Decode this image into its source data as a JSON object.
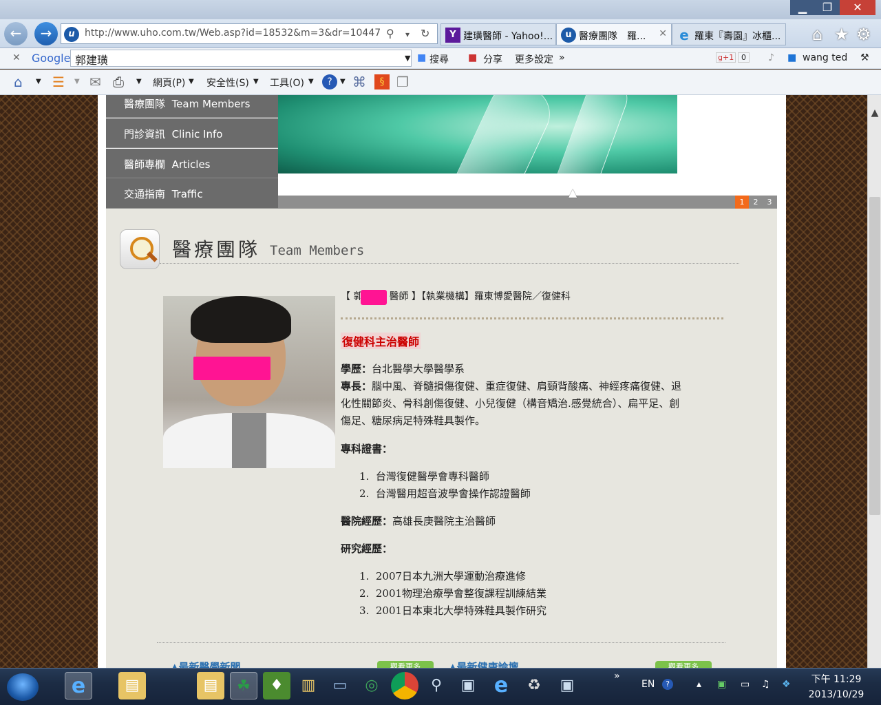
{
  "window": {
    "controls": {
      "minimize": "▁",
      "maximize": "❐",
      "close": "✕"
    }
  },
  "navbar": {
    "url": "http://www.uho.com.tw/Web.asp?id=18532&m=3&dr=10447",
    "tabs": [
      {
        "label": "建璜醫師 - Yahoo!...",
        "favicon": "Y",
        "color": "#5c1a9b"
      },
      {
        "label": "醫療團隊　羅...",
        "favicon": "u",
        "color": "#1c5aa8",
        "close": "✕"
      },
      {
        "label": "羅東『壽園』冰櫃...",
        "favicon": "e",
        "color": "#2a8cd8"
      }
    ],
    "icons": [
      "home-icon",
      "favorites-star-icon",
      "settings-gear-icon"
    ]
  },
  "google_toolbar": {
    "logo": "Google",
    "close": "✕",
    "search_value": "郭建璜",
    "search_button": "搜尋",
    "share": "分享",
    "more": "更多設定",
    "plus_one_count": "0",
    "user": "wang ted"
  },
  "command_bar": {
    "page": "網頁(P)",
    "safety": "安全性(S)",
    "tools": "工具(O)"
  },
  "site": {
    "nav": [
      {
        "zh": "醫療團隊",
        "en": "Team Members"
      },
      {
        "zh": "門診資訊",
        "en": "Clinic Info"
      },
      {
        "zh": "醫師專欄",
        "en": "Articles"
      },
      {
        "zh": "交通指南",
        "en": "Traffic"
      }
    ],
    "slides": [
      "1",
      "2",
      "3"
    ],
    "section_title": "醫療團隊",
    "section_subtitle": "Team Members",
    "doctor": {
      "heading_pre": "【 郭",
      "heading_post": "醫師 】【執業機構】羅東博愛醫院／復健科",
      "role": "復健科主治醫師",
      "education_label": "學歷：",
      "education": "台北醫學大學醫學系",
      "specialty_label": "專長：",
      "specialty_lines": [
        "腦中風、脊髓損傷復健、重症復健、肩頸背酸痛、神經疼痛復健、退",
        "化性關節炎、骨科創傷復健、小兒復健（構音矯治.感覺統合）、扁平足、創",
        "傷足、糖尿病足特殊鞋具製作。"
      ],
      "cert_label": "專科證書：",
      "certs": [
        "台灣復健醫學會專科醫師",
        "台灣醫用超音波學會操作認證醫師"
      ],
      "hospital_label": "醫院經歷：",
      "hospital": "高雄長庚醫院主治醫師",
      "research_label": "研究經歷：",
      "research": [
        "2007日本九洲大學運動治療進修",
        "2001物理治療學會整復課程訓練結業",
        "2001日本東北大學特殊鞋具製作研究"
      ]
    },
    "peek": {
      "left_link": "▲最新醫學新聞",
      "right_link": "▲最新健康論壇",
      "more_button": "觀看更多"
    }
  },
  "taskbar": {
    "lang": "EN",
    "clock_time": "下午 11:29",
    "clock_date": "2013/10/29"
  }
}
